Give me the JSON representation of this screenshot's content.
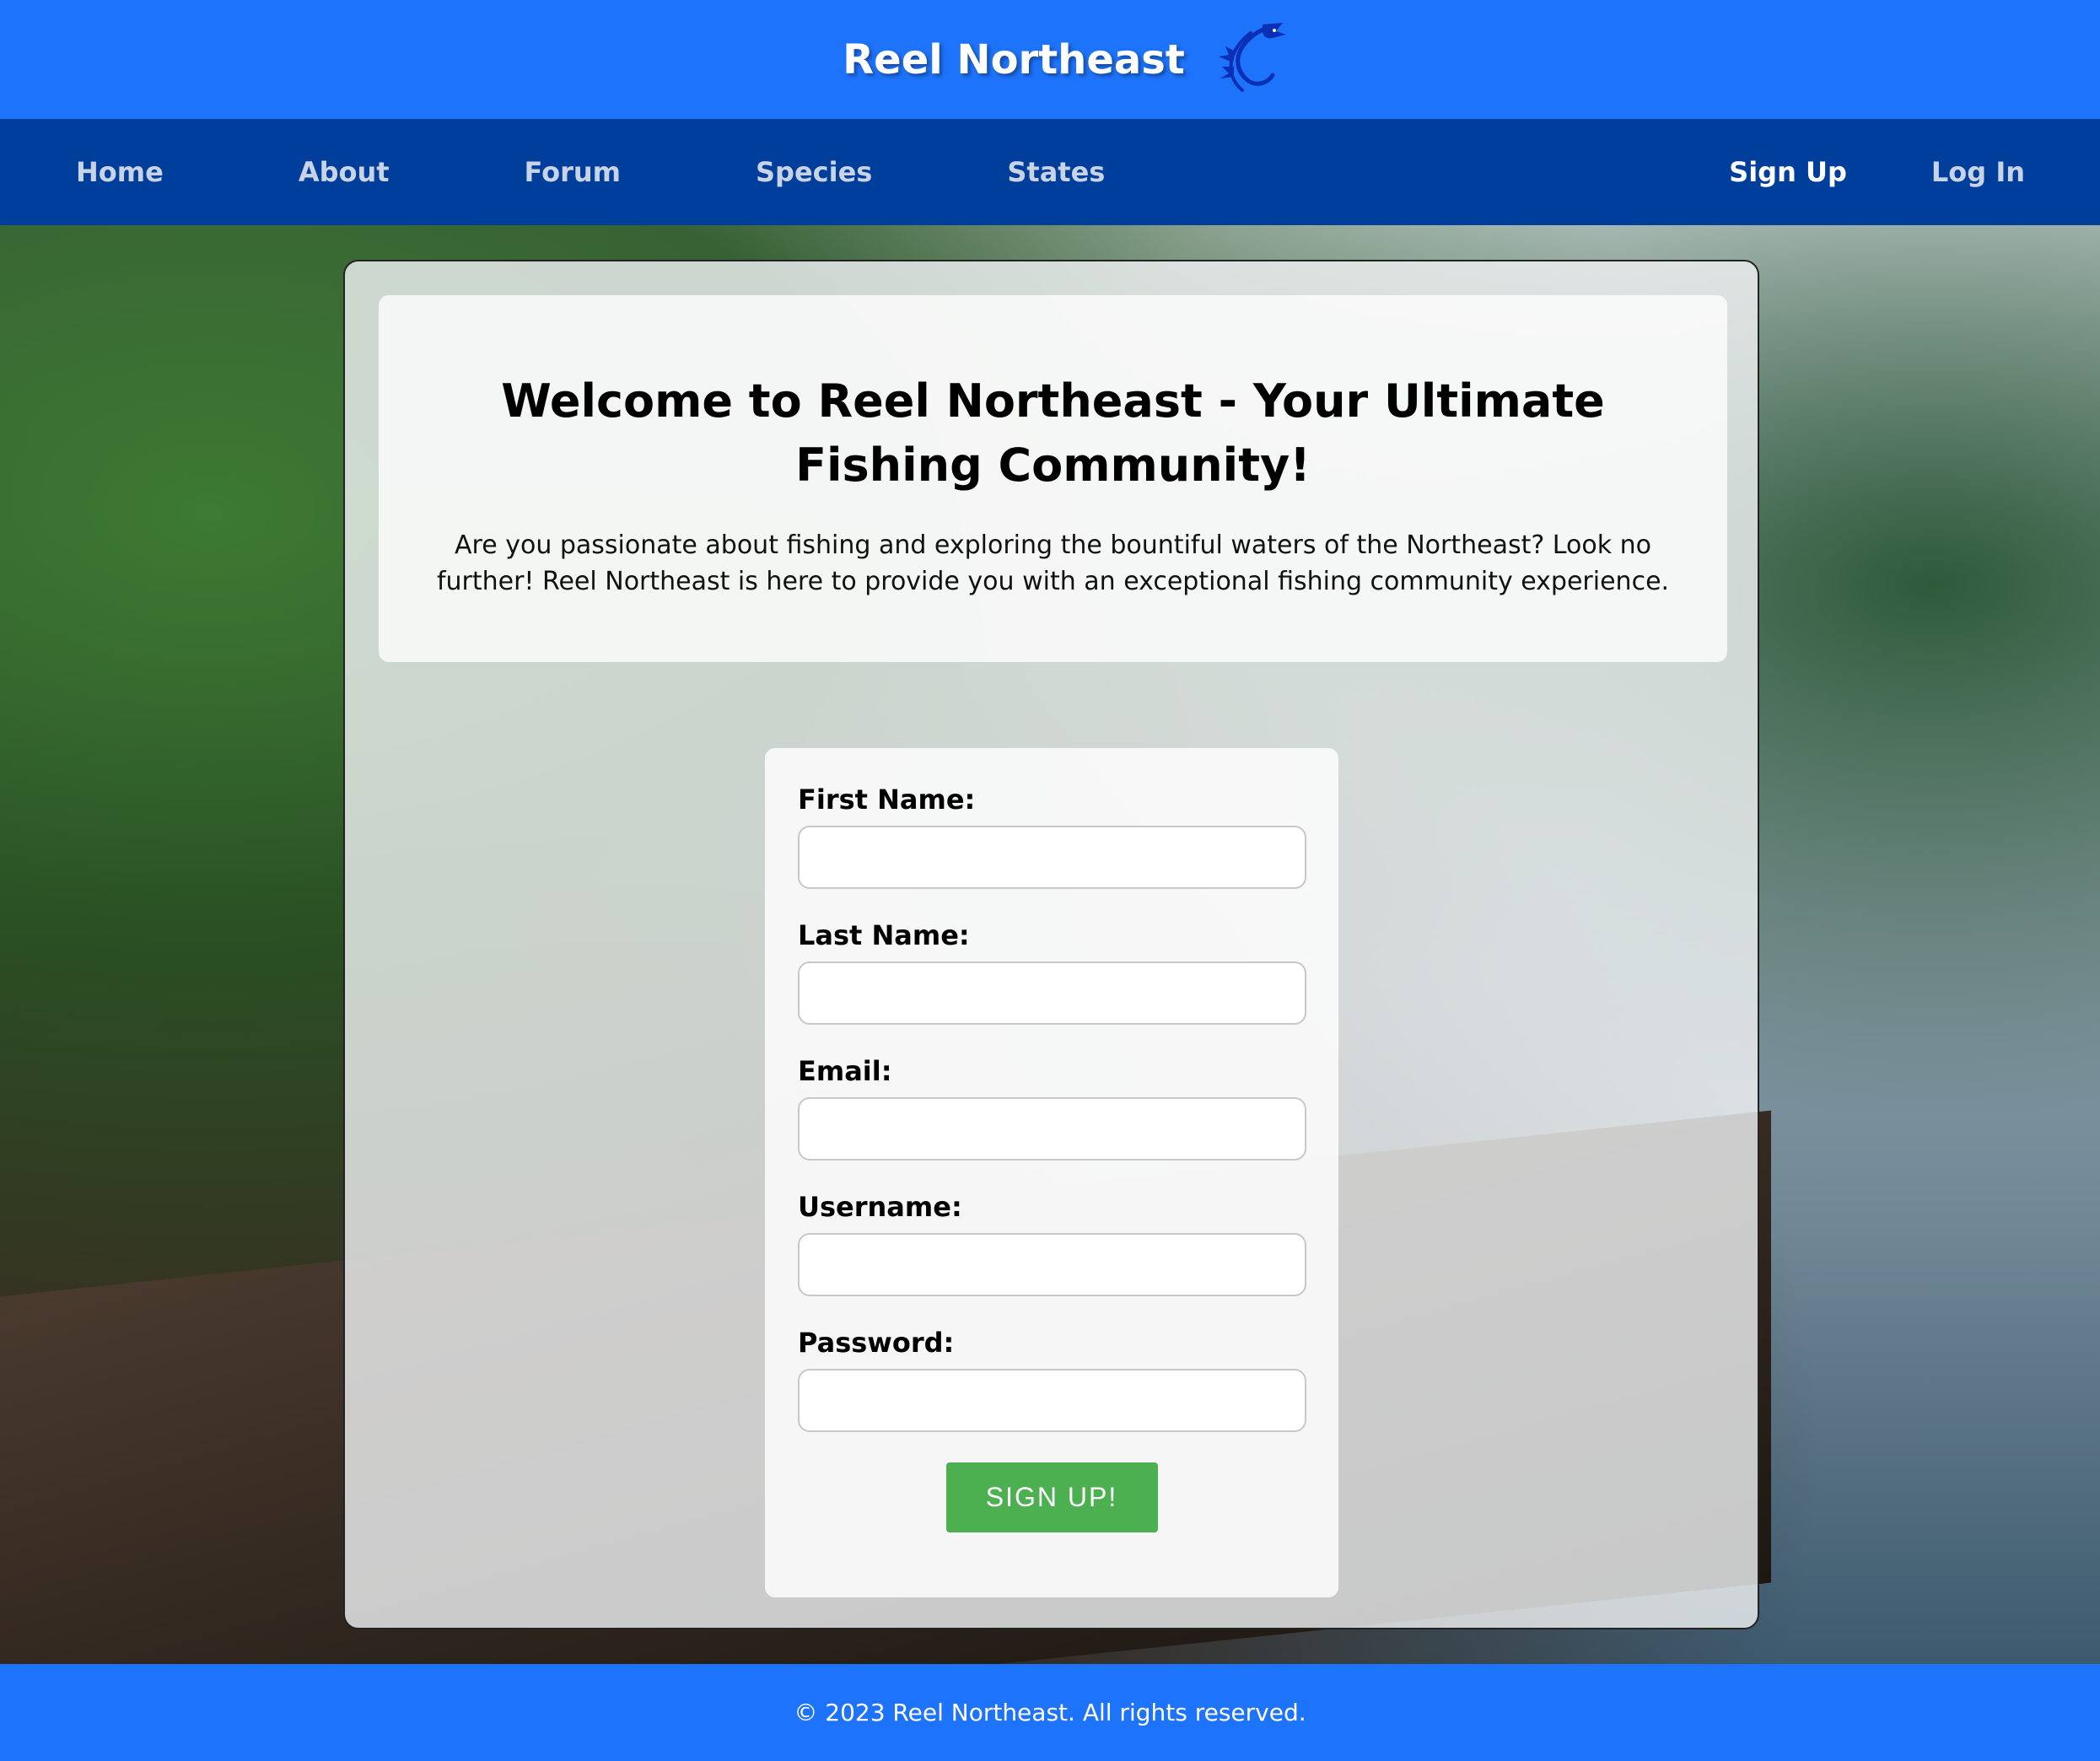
{
  "header": {
    "brand_title": "Reel Northeast",
    "logo_icon": "fish-hook-icon"
  },
  "nav": {
    "items": [
      "Home",
      "About",
      "Forum",
      "Species",
      "States"
    ],
    "sign_up": "Sign Up",
    "log_in": "Log In"
  },
  "welcome": {
    "heading": "Welcome to Reel Northeast - Your Ultimate Fishing Community!",
    "description": "Are you passionate about fishing and exploring the bountiful waters of the Northeast? Look no further! Reel Northeast is here to provide you with an exceptional fishing community experience."
  },
  "form": {
    "first_name_label": "First Name:",
    "first_name_value": "",
    "last_name_label": "Last Name:",
    "last_name_value": "",
    "email_label": "Email:",
    "email_value": "",
    "username_label": "Username:",
    "username_value": "",
    "password_label": "Password:",
    "password_value": "",
    "submit_label": "SIGN UP!"
  },
  "footer": {
    "copyright": "© 2023 Reel Northeast. All rights reserved."
  },
  "colors": {
    "header_blue": "#1e73fb",
    "nav_blue": "#003e9c",
    "submit_green": "#4caf50"
  }
}
